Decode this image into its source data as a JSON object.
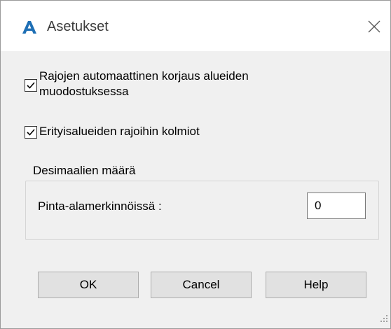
{
  "window": {
    "title": "Asetukset",
    "icon": "autocad-a-icon",
    "close_icon": "close-icon"
  },
  "options": {
    "auto_fix": {
      "label_line1": "Rajojen automaattinen korjaus alueiden",
      "label_line2": "muodostuksessa",
      "checked": true
    },
    "special_triangles": {
      "label": "Erityisalueiden rajoihin kolmiot",
      "checked": true
    }
  },
  "decimals_group": {
    "legend": "Desimaalien määrä",
    "field_label": "Pinta-alamerkinnöissä :",
    "field_value": "0"
  },
  "buttons": {
    "ok": "OK",
    "cancel": "Cancel",
    "help": "Help"
  },
  "colors": {
    "accent": "#1e6fb5",
    "dialog_bg": "#f0f0f0",
    "button_bg": "#e1e1e1"
  }
}
